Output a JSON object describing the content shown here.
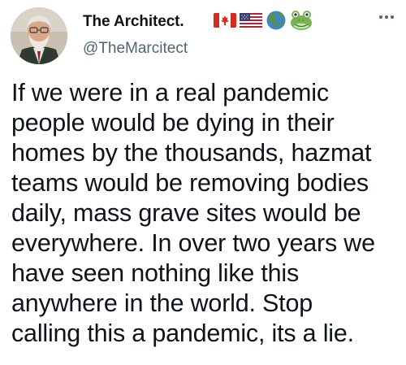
{
  "tweet": {
    "author": {
      "display_name": "The Architect.",
      "handle": "@TheMarcitect",
      "name_emojis": [
        "flag-canada-icon",
        "flag-usa-icon",
        "earth-globe-americas-icon",
        "frog-face-icon"
      ]
    },
    "more_icon": "more-horizontal-icon",
    "text_lines": [
      "If we were in a real pandemic",
      "people would be dying in their",
      "homes by the thousands, hazmat",
      "teams would be removing bodies",
      "daily, mass grave sites would be",
      "everywhere. In over two years we",
      "have seen nothing like this",
      "anywhere in the world. Stop",
      "calling this a pandemic, its a lie."
    ]
  },
  "colors": {
    "text_primary": "#0f1419",
    "text_secondary": "#536471",
    "canada_red": "#d52b1e",
    "usa_blue": "#3c3b6e",
    "globe_blue": "#3b88c3",
    "globe_green": "#5c913b",
    "frog_green": "#77b255"
  }
}
